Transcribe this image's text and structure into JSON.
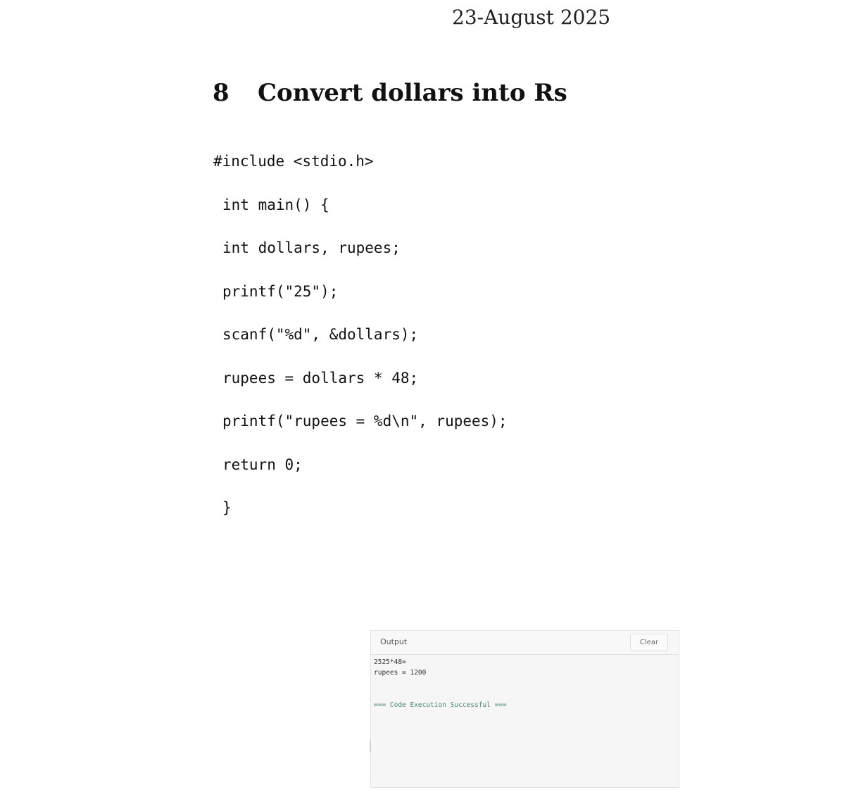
{
  "header": {
    "date": "23-August 2025"
  },
  "section": {
    "number": "8",
    "title": "Convert dollars into Rs"
  },
  "code": {
    "lines": [
      "#include <stdio.h>",
      "int main() {",
      "int dollars, rupees;",
      "printf(\"25\");",
      "scanf(\"%d\", &dollars);",
      "rupees = dollars * 48;",
      "printf(\"rupees = %d\\n\", rupees);",
      "return 0;",
      "}"
    ]
  },
  "output_panel": {
    "title": "Output",
    "clear_label": "Clear",
    "lines": [
      "2525*48=",
      "rupees = 1200"
    ],
    "status": "=== Code Execution Successful ==="
  }
}
